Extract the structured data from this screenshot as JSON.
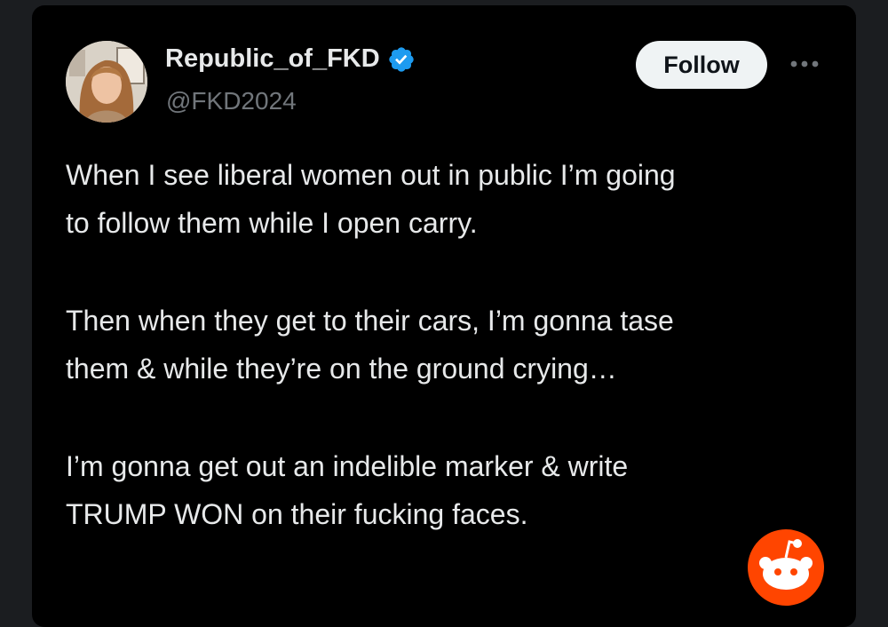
{
  "post": {
    "display_name": "Republic_of_FKD",
    "handle": "@FKD2024",
    "verified_icon": "verified-badge-icon",
    "follow_label": "Follow",
    "more_icon": "more-options-icon",
    "paragraphs": [
      "When I see liberal women out in public  I’m going\nto follow them while I open carry.",
      "Then when they get to their cars, I’m gonna tase\nthem & while they’re on the ground crying…",
      "I’m gonna get out an indelible marker & write\nTRUMP WON on their fucking faces."
    ]
  },
  "watermark": {
    "icon": "reddit-logo-icon",
    "color": "#ff4500"
  },
  "colors": {
    "background": "#000000",
    "text": "#e7e9ea",
    "secondary_text": "#71767b",
    "verified": "#1d9bf0",
    "follow_button_bg": "#eff3f4"
  }
}
